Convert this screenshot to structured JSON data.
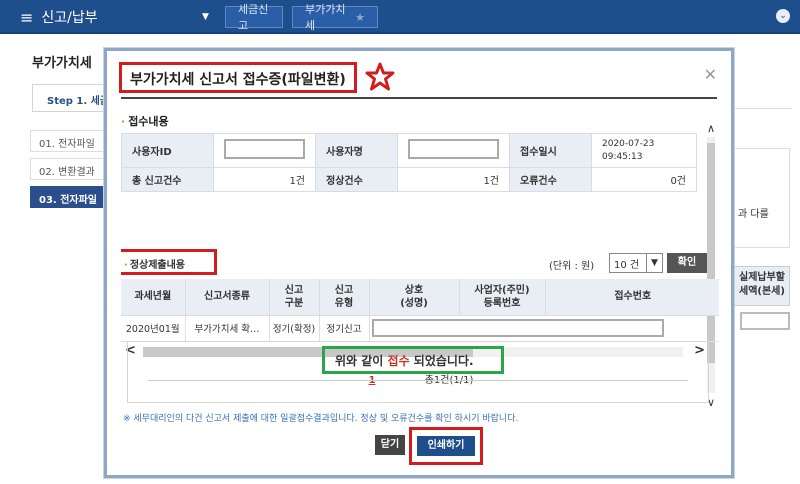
{
  "nav": {
    "menu_label": "신고/납부",
    "crumbs": [
      "세금신고",
      "부가가치세"
    ]
  },
  "background": {
    "page_title": "부가가치세",
    "step_tab": "Step 1. 세금",
    "side_items": [
      "01. 전자파일",
      "02. 변환결과",
      "03. 전자파일"
    ],
    "right_text": "과 다를",
    "right_header": "실제납부할 세액(본세)"
  },
  "dialog": {
    "title": "부가가치세 신고서 접수증(파일변환)",
    "section1_label": "접수내용",
    "info": {
      "user_id_label": "사용자ID",
      "user_name_label": "사용자명",
      "received_label": "접수일시",
      "received_date": "2020-07-23",
      "received_time": "09:45:13",
      "total_label": "총 신고건수",
      "total_value": "1건",
      "normal_label": "정상건수",
      "normal_value": "1건",
      "error_label": "오류건수",
      "error_value": "0건"
    },
    "section2_label": "정상제출내용",
    "unit_label": "(단위 : 원)",
    "per_page": "10 건",
    "confirm_button": "확인",
    "grid_headers": [
      "과세년월",
      "신고서종류",
      "신고\n구분",
      "신고\n유형",
      "상호\n(성명)",
      "사업자(주민)\n등록번호",
      "접수번호"
    ],
    "grid_row": [
      "2020년01월",
      "부가가치세 확…",
      "정기(확정)",
      "정기신고"
    ],
    "pager_current": "1",
    "pager_summary": "총1건(1/1)",
    "done_prefix": "위와 같이 ",
    "done_highlight": "접수",
    "done_suffix": " 되었습니다.",
    "notice": "※ 세무대리인의 다건 신고서 제출에 대한 일괄접수결과입니다. 정상 및 오류건수를 확인 하시기 바랍니다.",
    "close_button": "닫기",
    "print_button": "인쇄하기"
  },
  "colors": {
    "nav_bg": "#1f4e8c",
    "highlight_red": "#d11d1d",
    "highlight_green": "#2aa54a",
    "star_red": "#d11d1d"
  }
}
